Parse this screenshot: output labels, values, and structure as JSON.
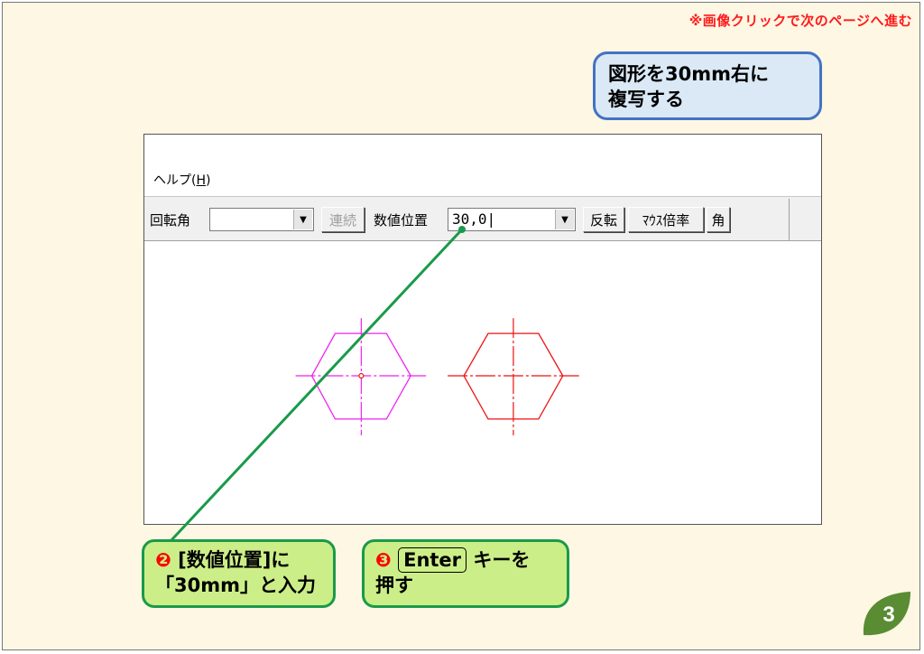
{
  "slide": {
    "nav_note": "※画像クリックで次のページへ進む",
    "title_line1": "図形を30mm右に",
    "title_line2": "複写する",
    "page_number": "3"
  },
  "app": {
    "menu": {
      "help_label": "ヘルプ(",
      "help_accel": "H",
      "help_close": ")"
    },
    "toolbar": {
      "rotation_label": "回転角",
      "rotation_value": "",
      "continuous_button": "連続",
      "numeric_position_label": "数値位置",
      "numeric_position_value": "30,0|",
      "flip_button": "反転",
      "mouse_scale_button": "ﾏｳｽ倍率",
      "angle_button": "角"
    },
    "canvas": {
      "colors": {
        "selected_shape": "#ee22ee",
        "copied_shape": "#ee1111"
      }
    }
  },
  "callouts": {
    "step2_marker": "❷",
    "step2_line1": "[数値位置]に",
    "step2_line2": "「30mm」と入力",
    "step3_marker": "❸",
    "step3_key": "Enter",
    "step3_line1_rest": "キーを",
    "step3_line2": "押す"
  },
  "colors": {
    "slide_bg": "#fdf7e3",
    "title_box_bg": "#dbe9f6",
    "title_box_border": "#4472c4",
    "callout_bg": "#ccee88",
    "callout_border": "#1a9a4a",
    "accent_red": "#ff1a1a",
    "leaf_green": "#5a8c33"
  }
}
